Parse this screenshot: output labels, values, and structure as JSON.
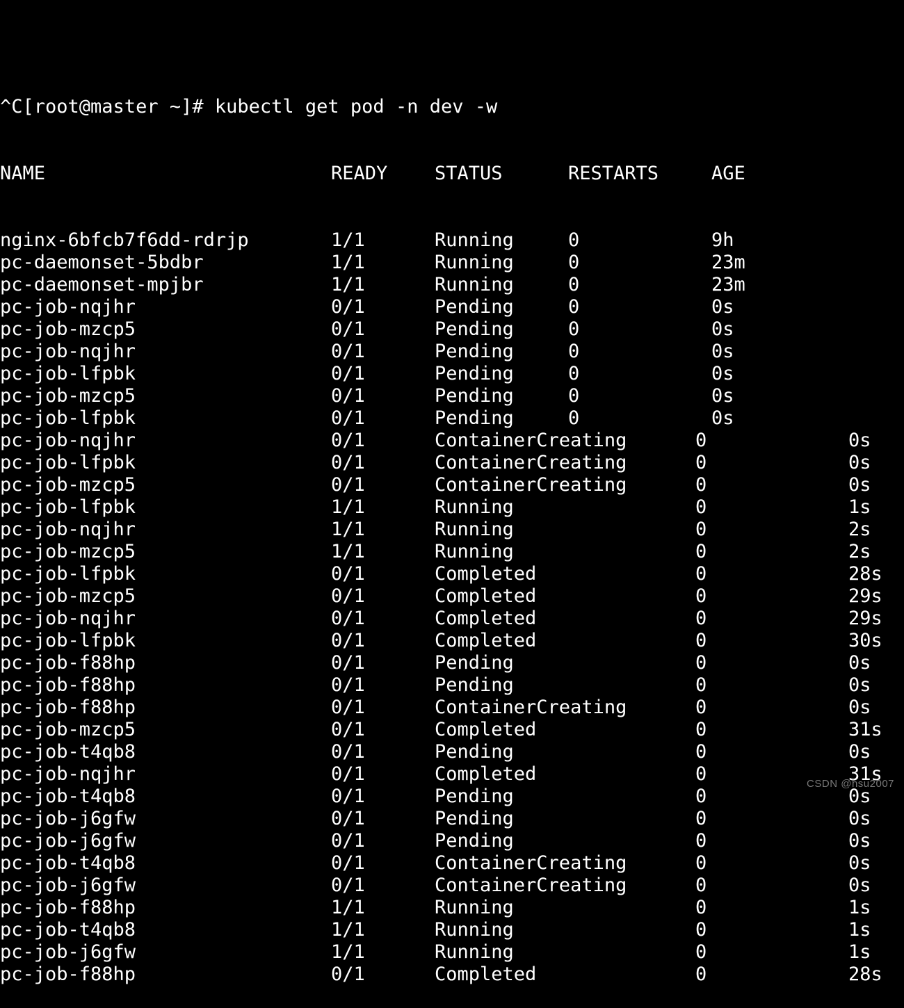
{
  "terminal": {
    "background_color": "#000000",
    "foreground_color": "#ffffff",
    "prompt_line": "^C[root@master ~]# kubectl get pod -n dev -w",
    "clipped_top_line": "",
    "columns": [
      "NAME",
      "READY",
      "STATUS",
      "RESTARTS",
      "AGE"
    ],
    "header": {
      "name": "NAME",
      "ready": "READY",
      "status": "STATUS",
      "restarts": "RESTARTS",
      "age": "AGE"
    },
    "rows": [
      {
        "name": "nginx-6bfcb7f6dd-rdrjp",
        "ready": "1/1",
        "status": "Running",
        "restarts": "0",
        "age": "9h",
        "layout": "n"
      },
      {
        "name": "pc-daemonset-5bdbr",
        "ready": "1/1",
        "status": "Running",
        "restarts": "0",
        "age": "23m",
        "layout": "n"
      },
      {
        "name": "pc-daemonset-mpjbr",
        "ready": "1/1",
        "status": "Running",
        "restarts": "0",
        "age": "23m",
        "layout": "n"
      },
      {
        "name": "pc-job-nqjhr",
        "ready": "0/1",
        "status": "Pending",
        "restarts": "0",
        "age": "0s",
        "layout": "n"
      },
      {
        "name": "pc-job-mzcp5",
        "ready": "0/1",
        "status": "Pending",
        "restarts": "0",
        "age": "0s",
        "layout": "n"
      },
      {
        "name": "pc-job-nqjhr",
        "ready": "0/1",
        "status": "Pending",
        "restarts": "0",
        "age": "0s",
        "layout": "n"
      },
      {
        "name": "pc-job-lfpbk",
        "ready": "0/1",
        "status": "Pending",
        "restarts": "0",
        "age": "0s",
        "layout": "n"
      },
      {
        "name": "pc-job-mzcp5",
        "ready": "0/1",
        "status": "Pending",
        "restarts": "0",
        "age": "0s",
        "layout": "n"
      },
      {
        "name": "pc-job-lfpbk",
        "ready": "0/1",
        "status": "Pending",
        "restarts": "0",
        "age": "0s",
        "layout": "n"
      },
      {
        "name": "pc-job-nqjhr",
        "ready": "0/1",
        "status": "ContainerCreating",
        "restarts": "0",
        "age": "0s",
        "layout": "w"
      },
      {
        "name": "pc-job-lfpbk",
        "ready": "0/1",
        "status": "ContainerCreating",
        "restarts": "0",
        "age": "0s",
        "layout": "w"
      },
      {
        "name": "pc-job-mzcp5",
        "ready": "0/1",
        "status": "ContainerCreating",
        "restarts": "0",
        "age": "0s",
        "layout": "w"
      },
      {
        "name": "pc-job-lfpbk",
        "ready": "1/1",
        "status": "Running",
        "restarts": "0",
        "age": "1s",
        "layout": "w"
      },
      {
        "name": "pc-job-nqjhr",
        "ready": "1/1",
        "status": "Running",
        "restarts": "0",
        "age": "2s",
        "layout": "w"
      },
      {
        "name": "pc-job-mzcp5",
        "ready": "1/1",
        "status": "Running",
        "restarts": "0",
        "age": "2s",
        "layout": "w"
      },
      {
        "name": "pc-job-lfpbk",
        "ready": "0/1",
        "status": "Completed",
        "restarts": "0",
        "age": "28s",
        "layout": "w"
      },
      {
        "name": "pc-job-mzcp5",
        "ready": "0/1",
        "status": "Completed",
        "restarts": "0",
        "age": "29s",
        "layout": "w"
      },
      {
        "name": "pc-job-nqjhr",
        "ready": "0/1",
        "status": "Completed",
        "restarts": "0",
        "age": "29s",
        "layout": "w"
      },
      {
        "name": "pc-job-lfpbk",
        "ready": "0/1",
        "status": "Completed",
        "restarts": "0",
        "age": "30s",
        "layout": "w"
      },
      {
        "name": "pc-job-f88hp",
        "ready": "0/1",
        "status": "Pending",
        "restarts": "0",
        "age": "0s",
        "layout": "w"
      },
      {
        "name": "pc-job-f88hp",
        "ready": "0/1",
        "status": "Pending",
        "restarts": "0",
        "age": "0s",
        "layout": "w"
      },
      {
        "name": "pc-job-f88hp",
        "ready": "0/1",
        "status": "ContainerCreating",
        "restarts": "0",
        "age": "0s",
        "layout": "w"
      },
      {
        "name": "pc-job-mzcp5",
        "ready": "0/1",
        "status": "Completed",
        "restarts": "0",
        "age": "31s",
        "layout": "w"
      },
      {
        "name": "pc-job-t4qb8",
        "ready": "0/1",
        "status": "Pending",
        "restarts": "0",
        "age": "0s",
        "layout": "w"
      },
      {
        "name": "pc-job-nqjhr",
        "ready": "0/1",
        "status": "Completed",
        "restarts": "0",
        "age": "31s",
        "layout": "w"
      },
      {
        "name": "pc-job-t4qb8",
        "ready": "0/1",
        "status": "Pending",
        "restarts": "0",
        "age": "0s",
        "layout": "w"
      },
      {
        "name": "pc-job-j6gfw",
        "ready": "0/1",
        "status": "Pending",
        "restarts": "0",
        "age": "0s",
        "layout": "w"
      },
      {
        "name": "pc-job-j6gfw",
        "ready": "0/1",
        "status": "Pending",
        "restarts": "0",
        "age": "0s",
        "layout": "w"
      },
      {
        "name": "pc-job-t4qb8",
        "ready": "0/1",
        "status": "ContainerCreating",
        "restarts": "0",
        "age": "0s",
        "layout": "w"
      },
      {
        "name": "pc-job-j6gfw",
        "ready": "0/1",
        "status": "ContainerCreating",
        "restarts": "0",
        "age": "0s",
        "layout": "w"
      },
      {
        "name": "pc-job-f88hp",
        "ready": "1/1",
        "status": "Running",
        "restarts": "0",
        "age": "1s",
        "layout": "w"
      },
      {
        "name": "pc-job-t4qb8",
        "ready": "1/1",
        "status": "Running",
        "restarts": "0",
        "age": "1s",
        "layout": "w"
      },
      {
        "name": "pc-job-j6gfw",
        "ready": "1/1",
        "status": "Running",
        "restarts": "0",
        "age": "1s",
        "layout": "w"
      },
      {
        "name": "pc-job-f88hp",
        "ready": "0/1",
        "status": "Completed",
        "restarts": "0",
        "age": "28s",
        "layout": "w"
      }
    ]
  },
  "watermark": {
    "text": "CSDN @hsu2007"
  }
}
